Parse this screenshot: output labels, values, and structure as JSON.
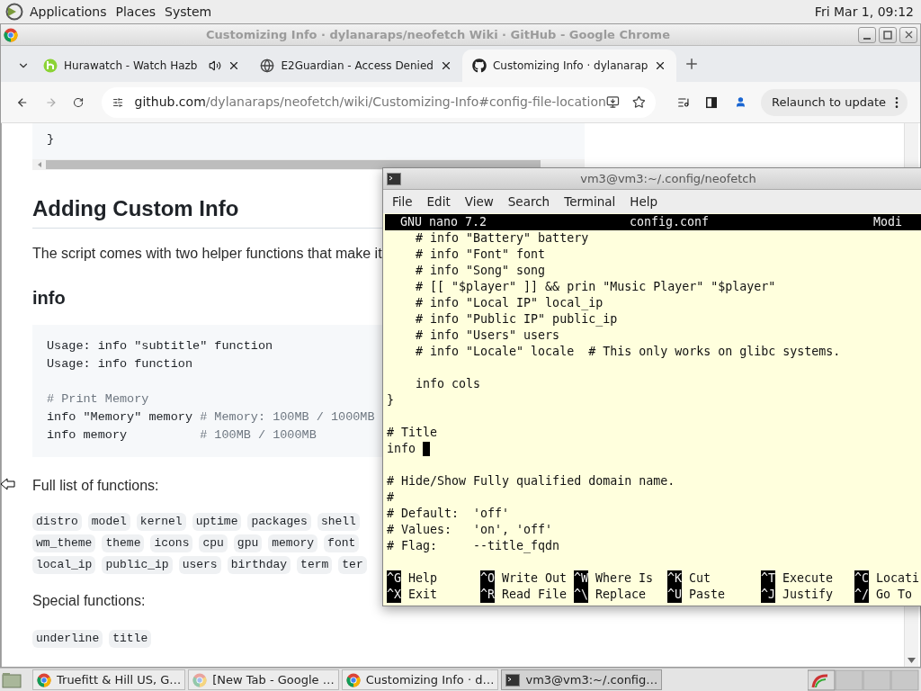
{
  "desktop_panel": {
    "menus": [
      "Applications",
      "Places",
      "System"
    ],
    "clock": "Fri Mar 1, 09:12"
  },
  "browser": {
    "title": "Customizing Info · dylanaraps/neofetch Wiki · GitHub - Google Chrome",
    "tabs": [
      {
        "title": "Hurawatch - Watch Hazb",
        "kind": "hurawatch",
        "playing_audio": true,
        "selected": false
      },
      {
        "title": "E2Guardian - Access Denied",
        "kind": "globe",
        "playing_audio": false,
        "selected": false
      },
      {
        "title": "Customizing Info · dylanarap",
        "kind": "github",
        "playing_audio": false,
        "selected": true
      }
    ],
    "address": {
      "host": "github.com",
      "path": "/dylanaraps/neofetch/wiki/Customizing-Info#config-file-location"
    },
    "relaunch": "Relaunch to update"
  },
  "page": {
    "code_tail": "}",
    "heading": "Adding Custom Info",
    "intro": "The script comes with two helper functions that make it",
    "subheading": "info",
    "code_groups": [
      [
        [
          {
            "kind": "code",
            "text": "Usage: info \"subtitle\" function"
          }
        ],
        [
          {
            "kind": "code",
            "text": "Usage: info function"
          }
        ]
      ],
      [
        [
          {
            "kind": "comment",
            "text": "# Print Memory"
          }
        ],
        [
          {
            "kind": "code",
            "text": "info \"Memory\" memory "
          },
          {
            "kind": "comment",
            "text": "# Memory: 100MB / 1000MB"
          }
        ],
        [
          {
            "kind": "code",
            "text": "info memory          "
          },
          {
            "kind": "comment",
            "text": "# 100MB / 1000MB"
          }
        ]
      ]
    ],
    "full_list_label": "Full list of functions:",
    "functions": [
      [
        "distro",
        "model",
        "kernel",
        "uptime",
        "packages",
        "shell"
      ],
      [
        "wm_theme",
        "theme",
        "icons",
        "cpu",
        "gpu",
        "memory",
        "font"
      ],
      [
        "local_ip",
        "public_ip",
        "users",
        "birthday",
        "term",
        "ter"
      ]
    ],
    "special_label": "Special functions:",
    "special_functions": [
      "underline",
      "title"
    ]
  },
  "terminal": {
    "title": "vm3@vm3:~/.config/neofetch",
    "menus": [
      "File",
      "Edit",
      "View",
      "Search",
      "Terminal",
      "Help"
    ],
    "header": {
      "version": "GNU nano 7.2",
      "file": "config.conf",
      "state": "Modi"
    },
    "lines": [
      {
        "kind": "text",
        "text": "    # info \"Battery\" battery"
      },
      {
        "kind": "text",
        "text": "    # info \"Font\" font"
      },
      {
        "kind": "text",
        "text": "    # info \"Song\" song"
      },
      {
        "kind": "text",
        "text": "    # [[ \"$player\" ]] && prin \"Music Player\" \"$player\""
      },
      {
        "kind": "text",
        "text": "    # info \"Local IP\" local_ip"
      },
      {
        "kind": "text",
        "text": "    # info \"Public IP\" public_ip"
      },
      {
        "kind": "text",
        "text": "    # info \"Users\" users"
      },
      {
        "kind": "text",
        "text": "    # info \"Locale\" locale  # This only works on glibc systems."
      },
      {
        "kind": "blank"
      },
      {
        "kind": "text",
        "text": "    info cols"
      },
      {
        "kind": "text",
        "text": "}"
      },
      {
        "kind": "blank"
      },
      {
        "kind": "text",
        "text": "# Title"
      },
      {
        "kind": "cursor",
        "text": "info "
      },
      {
        "kind": "blank"
      },
      {
        "kind": "text",
        "text": "# Hide/Show Fully qualified domain name."
      },
      {
        "kind": "text",
        "text": "#"
      },
      {
        "kind": "text",
        "text": "# Default:  'off'"
      },
      {
        "kind": "text",
        "text": "# Values:   'on', 'off'"
      },
      {
        "kind": "text",
        "text": "# Flag:     --title_fqdn"
      },
      {
        "kind": "blank"
      }
    ],
    "shortcuts": [
      [
        {
          "key": "^G",
          "label": "Help"
        },
        {
          "key": "^O",
          "label": "Write Out"
        },
        {
          "key": "^W",
          "label": "Where Is"
        },
        {
          "key": "^K",
          "label": "Cut"
        },
        {
          "key": "^T",
          "label": "Execute"
        },
        {
          "key": "^C",
          "label": "Locati"
        }
      ],
      [
        {
          "key": "^X",
          "label": "Exit"
        },
        {
          "key": "^R",
          "label": "Read File"
        },
        {
          "key": "^\\",
          "label": "Replace"
        },
        {
          "key": "^U",
          "label": "Paste"
        },
        {
          "key": "^J",
          "label": "Justify"
        },
        {
          "key": "^/",
          "label": "Go To"
        }
      ]
    ]
  },
  "taskbar": [
    {
      "title": "Truefitt & Hill US, G…",
      "kind": "chrome",
      "selected": false
    },
    {
      "title": "[New Tab - Google …",
      "kind": "chrome-faded",
      "selected": false
    },
    {
      "title": "Customizing Info · d…",
      "kind": "chrome",
      "selected": false
    },
    {
      "title": "vm3@vm3:~/.config…",
      "kind": "terminal",
      "selected": true
    }
  ]
}
